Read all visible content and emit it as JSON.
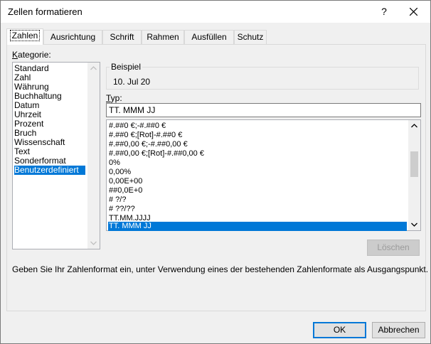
{
  "window": {
    "title": "Zellen formatieren",
    "help_label": "?"
  },
  "tabs": [
    {
      "label": "Zahlen",
      "active": true
    },
    {
      "label": "Ausrichtung",
      "active": false
    },
    {
      "label": "Schrift",
      "active": false
    },
    {
      "label": "Rahmen",
      "active": false
    },
    {
      "label": "Ausfüllen",
      "active": false
    },
    {
      "label": "Schutz",
      "active": false
    }
  ],
  "category": {
    "label_first": "K",
    "label_rest": "ategorie:",
    "items": [
      "Standard",
      "Zahl",
      "Währung",
      "Buchhaltung",
      "Datum",
      "Uhrzeit",
      "Prozent",
      "Bruch",
      "Wissenschaft",
      "Text",
      "Sonderformat",
      "Benutzerdefiniert"
    ],
    "selected": "Benutzerdefiniert"
  },
  "sample": {
    "caption": "Beispiel",
    "value": "10. Jul 20"
  },
  "type": {
    "label_first": "T",
    "label_rest": "yp:",
    "value": "TT. MMM JJ",
    "formats": [
      "#.##0 €;-#.##0 €",
      "#.##0 €;[Rot]-#.##0 €",
      "#.##0,00 €;-#.##0,00 €",
      "#.##0,00 €;[Rot]-#.##0,00 €",
      "0%",
      "0,00%",
      "0,00E+00",
      "##0,0E+0",
      "# ?/?",
      "# ??/??",
      "TT.MM.JJJJ",
      "TT. MMM JJ"
    ],
    "selected": "TT. MMM JJ"
  },
  "buttons": {
    "delete": "Löschen",
    "ok": "OK",
    "cancel": "Abbrechen"
  },
  "description": "Geben Sie Ihr Zahlenformat ein, unter Verwendung eines der bestehenden Zahlenformate als Ausgangspunkt.",
  "colors": {
    "selection": "#0078d7",
    "dialog_bg": "#f0f0f0"
  }
}
